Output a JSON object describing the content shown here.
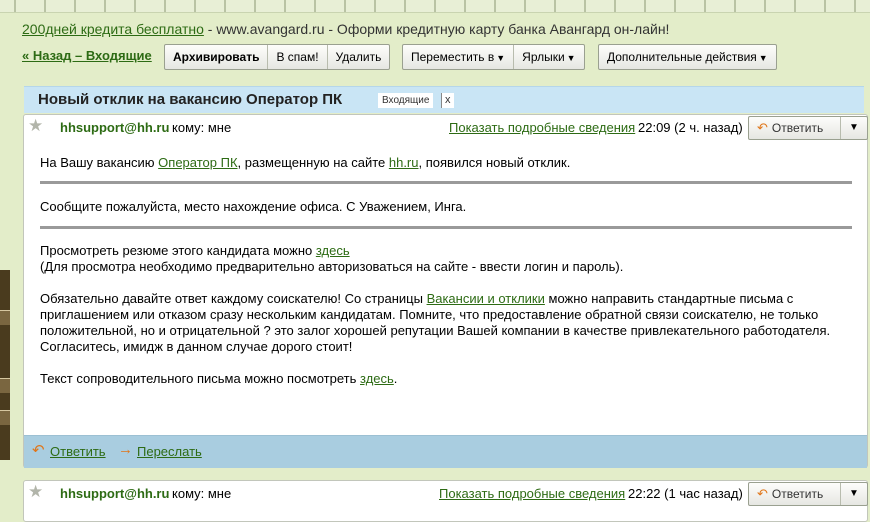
{
  "ad": {
    "link_text": "200дней кредита бесплатно",
    "text": " - www.avangard.ru - Оформи кредитную карту банка Авангард он-лайн!"
  },
  "toolbar": {
    "back_label": "« Назад – Входящие",
    "archive": "Архивировать",
    "spam": "В спам!",
    "delete": "Удалить",
    "move_to": "Переместить в",
    "labels": "Ярлыки",
    "more_actions": "Дополнительные действия"
  },
  "subject": {
    "title": "Новый отклик на вакансию Оператор ПК",
    "label": "Входящие",
    "label_close": "x"
  },
  "message": {
    "sender": "hhsupport@hh.ru",
    "recipient": "кому: мне",
    "details_link": "Показать подробные сведения",
    "time": "22:09 (2 ч. назад)",
    "reply": "Ответить",
    "body": {
      "p1_a": "На Вашу вакансию ",
      "p1_link1": "Оператор ПК",
      "p1_b": ", размещенную на сайте ",
      "p1_link2": "hh.ru",
      "p1_c": ", появился новый отклик.",
      "p2": "Сообщите пожалуйста, место нахождение офиса. С Уважением, Инга.",
      "p3_a": "Просмотреть резюме этого кандидата можно ",
      "p3_link": "здесь",
      "p3_b": "(Для просмотра необходимо предварительно авторизоваться на сайте - ввести логин и пароль).",
      "p4_a": "Обязательно давайте ответ каждому соискателю! Со страницы ",
      "p4_link": "Вакансии и отклики",
      "p4_b": " можно направить стандартные письма с приглашением или отказом сразу нескольким кандидатам. Помните, что предоставление обратной связи соискателю, не только положительной, но и отрицательной ? это залог хорошей репутации Вашей компании в качестве привлекательного работодателя. Согласитесь, имидж в данном случае дорого стоит!",
      "p5_a": "Текст сопроводительного письма можно посмотреть ",
      "p5_link": "здесь",
      "p5_b": "."
    },
    "footer": {
      "reply": "Ответить",
      "forward": "Переслать"
    }
  },
  "message2": {
    "sender": "hhsupport@hh.ru",
    "recipient": "кому: мне",
    "details_link": "Показать подробные сведения",
    "time": "22:22 (1 час назад)",
    "reply": "Ответить"
  },
  "icons": {
    "star": "star-icon",
    "reply": "reply-arrow-icon",
    "forward": "forward-arrow-icon",
    "dropdown": "chevron-down-icon"
  },
  "colors": {
    "link": "#2d6b14",
    "subject_bar": "#c9e5f5",
    "footer_bar": "#a9cde0",
    "reply_arrow": "#e0761a"
  }
}
